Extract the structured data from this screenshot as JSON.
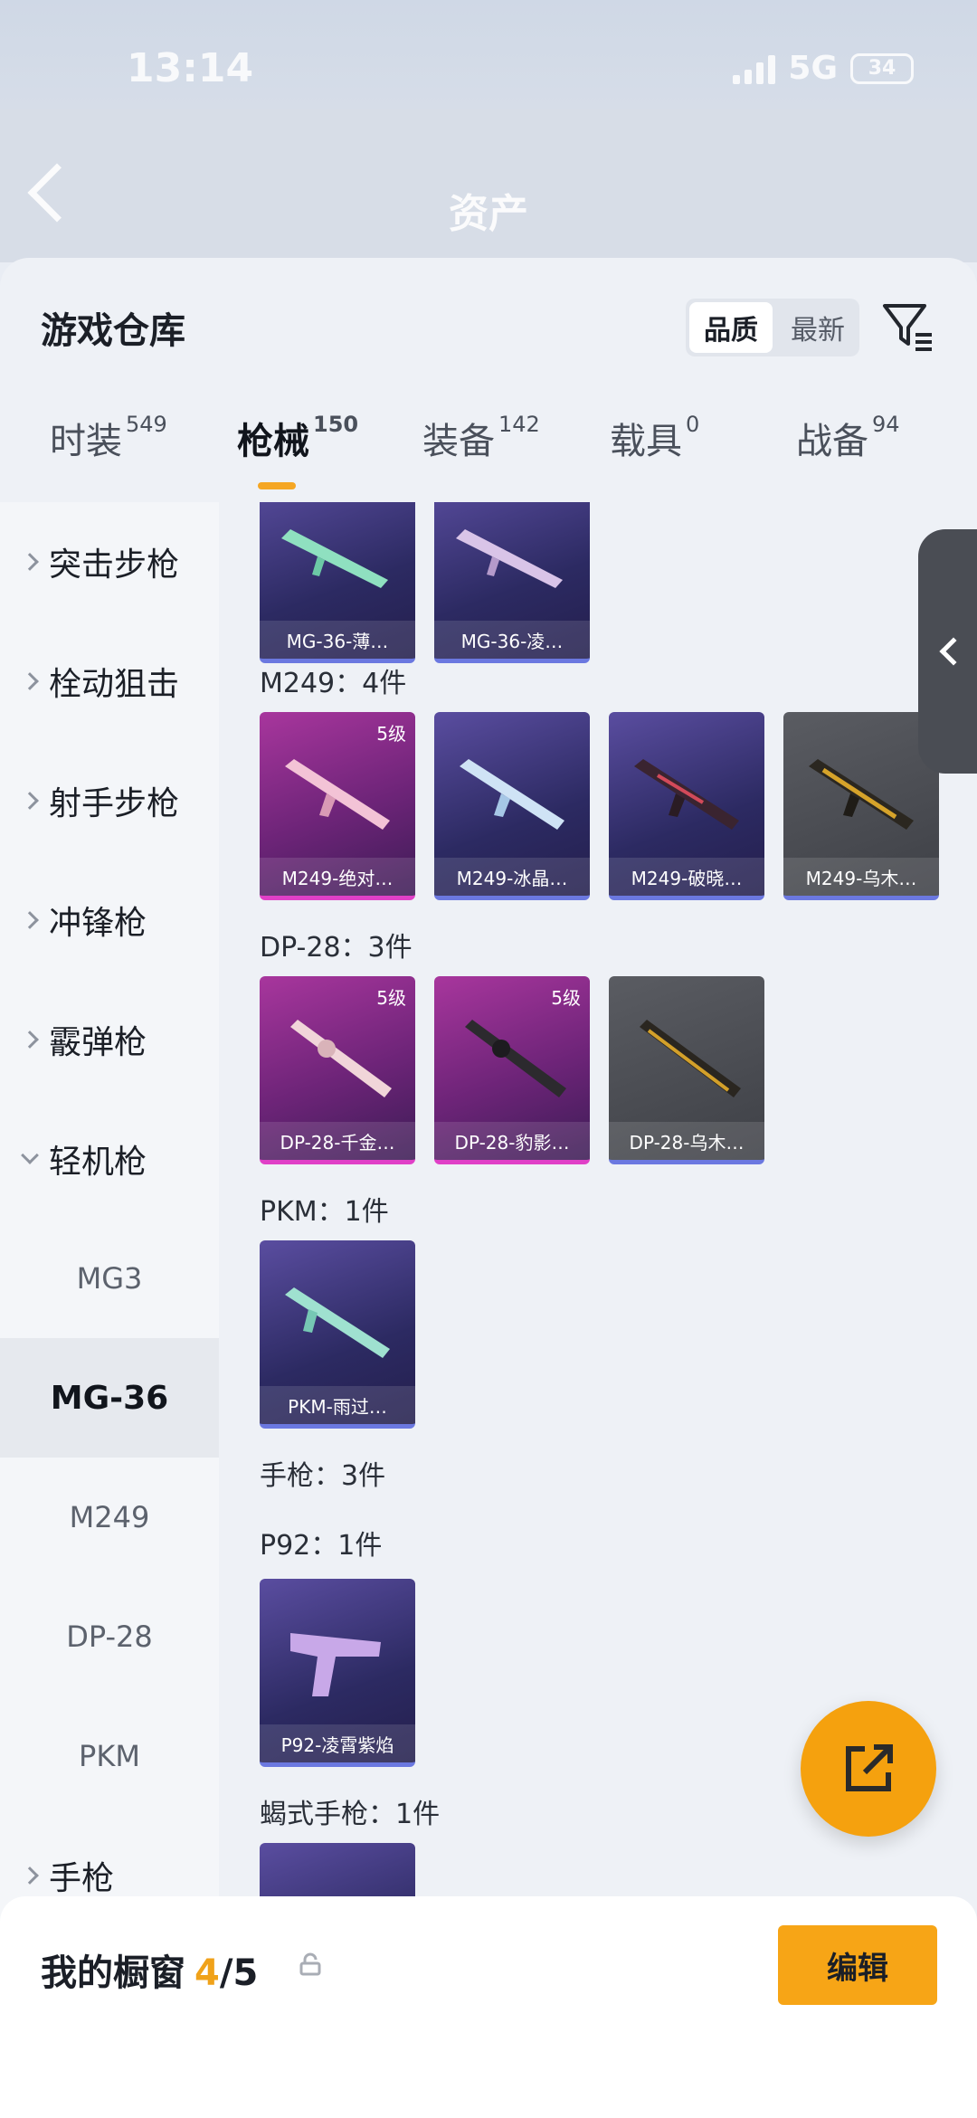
{
  "status": {
    "time": "13:14",
    "network": "5G",
    "battery": "34"
  },
  "nav": {
    "title": "资产"
  },
  "sheet": {
    "title": "游戏仓库",
    "sort": [
      "品质",
      "最新"
    ]
  },
  "tabs": [
    {
      "label": "时装",
      "count": "549"
    },
    {
      "label": "枪械",
      "count": "150"
    },
    {
      "label": "装备",
      "count": "142"
    },
    {
      "label": "载具",
      "count": "0"
    },
    {
      "label": "战备",
      "count": "94"
    }
  ],
  "sidebar": {
    "categories": [
      "突击步枪",
      "栓动狙击",
      "射手步枪",
      "冲锋枪",
      "霰弹枪",
      "轻机枪"
    ],
    "subs": [
      "MG3",
      "MG-36",
      "M249",
      "DP-28",
      "PKM"
    ],
    "tail": "手枪"
  },
  "groups": {
    "m249": "M249：4件",
    "dp28": "DP-28：3件",
    "pkm": "PKM：1件",
    "pistol": "手枪：3件",
    "p92": "P92：1件",
    "scorpion": "蝎式手枪：1件"
  },
  "cards": {
    "mg36_1": {
      "name": "MG-36-薄…"
    },
    "mg36_2": {
      "name": "MG-36-凌…"
    },
    "m249_1": {
      "name": "M249-绝对…",
      "level": "5级"
    },
    "m249_2": {
      "name": "M249-冰晶…"
    },
    "m249_3": {
      "name": "M249-破晓…"
    },
    "m249_4": {
      "name": "M249-乌木…"
    },
    "dp28_1": {
      "name": "DP-28-千金…",
      "level": "5级"
    },
    "dp28_2": {
      "name": "DP-28-豹影…",
      "level": "5级"
    },
    "dp28_3": {
      "name": "DP-28-乌木…"
    },
    "pkm_1": {
      "name": "PKM-雨过…"
    },
    "p92_1": {
      "name": "P92-凌霄紫焰"
    }
  },
  "bottom": {
    "label": "我的橱窗",
    "current": "4",
    "total": "/5",
    "edit": "编辑"
  },
  "colors": {
    "accent": "#f5a623",
    "purple": "#2c2a62",
    "pink": "#6d2478",
    "gray": "#3e4046"
  }
}
